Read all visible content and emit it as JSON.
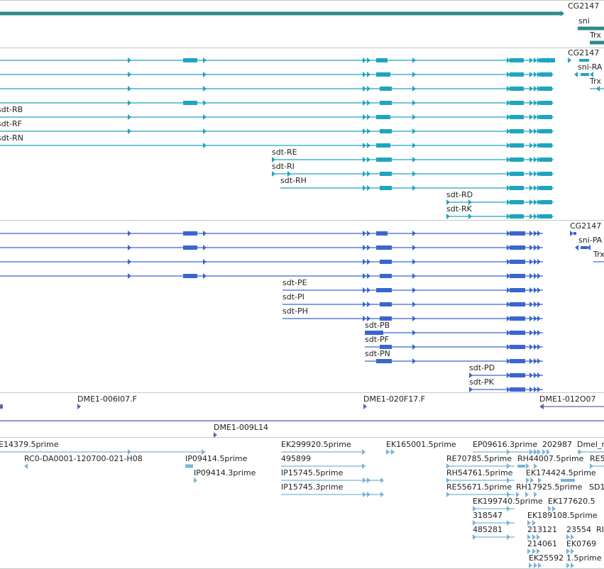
{
  "colors": {
    "track_gene": "#2e8b8b",
    "track_transcript": "#1fa5c0",
    "track_protein": "#3a66d0",
    "track_clone": "#7a55b8",
    "track_est": "#7ab4d8",
    "divider": "#c8c8c8",
    "label": "#222222"
  },
  "gene_track": {
    "labels": {
      "cg2147": "CG2147",
      "sni": "sni",
      "trx": "Trx"
    }
  },
  "transcript_track": {
    "labels": {
      "cg2147": "CG2147",
      "sni_ra": "sni-RA",
      "trx": "Trx",
      "sdt_rb": "sdt-RB",
      "sdt_rf": "sdt-RF",
      "sdt_rn": "sdt-RN",
      "sdt_re": "sdt-RE",
      "sdt_ri": "sdt-RI",
      "sdt_rh": "sdt-RH",
      "sdt_rd": "sdt-RD",
      "sdt_rk": "sdt-RK"
    }
  },
  "protein_track": {
    "labels": {
      "cg2147": "CG2147",
      "sni_pa": "sni-PA",
      "trx": "Trx",
      "sdt_pe": "sdt-PE",
      "sdt_pi": "sdt-PI",
      "sdt_ph": "sdt-PH",
      "sdt_pb": "sdt-PB",
      "sdt_pf": "sdt-PF",
      "sdt_pn": "sdt-PN",
      "sdt_pd": "sdt-PD",
      "sdt_pk": "sdt-PK"
    }
  },
  "clone_track": {
    "labels": {
      "c1": "DME1-006I07.F",
      "c2": "DME1-020F17.F",
      "c3": "DME1-012O07",
      "c4": "DME1-009L14"
    }
  },
  "est_track": {
    "labels": {
      "e1": "E14379.5prime",
      "e2": "RC0-DA0001-120700-021-H08",
      "e3": "IP09414.5prime",
      "e4": "IP09414.3prime",
      "e5": "EK299920.5prime",
      "e6": "495899",
      "e7": "IP15745.5prime",
      "e8": "IP15745.3prime",
      "e9": "EK165001.5prime",
      "e10": "EP09616.3prime",
      "e11": "202987",
      "e12": "Dmel_r",
      "e13": "RE70785.5prime",
      "e14": "RH44007.5prime",
      "e15": "RE5",
      "e16": "RH54761.5prime",
      "e17": "EK174424.5prime",
      "e18": "RE55671.5prime",
      "e19": "RH17925.5prime",
      "e20": "SD1",
      "e21": "EK199740.5prime",
      "e22": "EK177620.5",
      "e23": "318547",
      "e24": "EK189108.5prime",
      "e25": "485281",
      "e26": "213121",
      "e27": "23554",
      "e28": "RI",
      "e29": "214061",
      "e30": "EK0769",
      "e31": "EK25592",
      "e32": "1.5prime"
    }
  }
}
